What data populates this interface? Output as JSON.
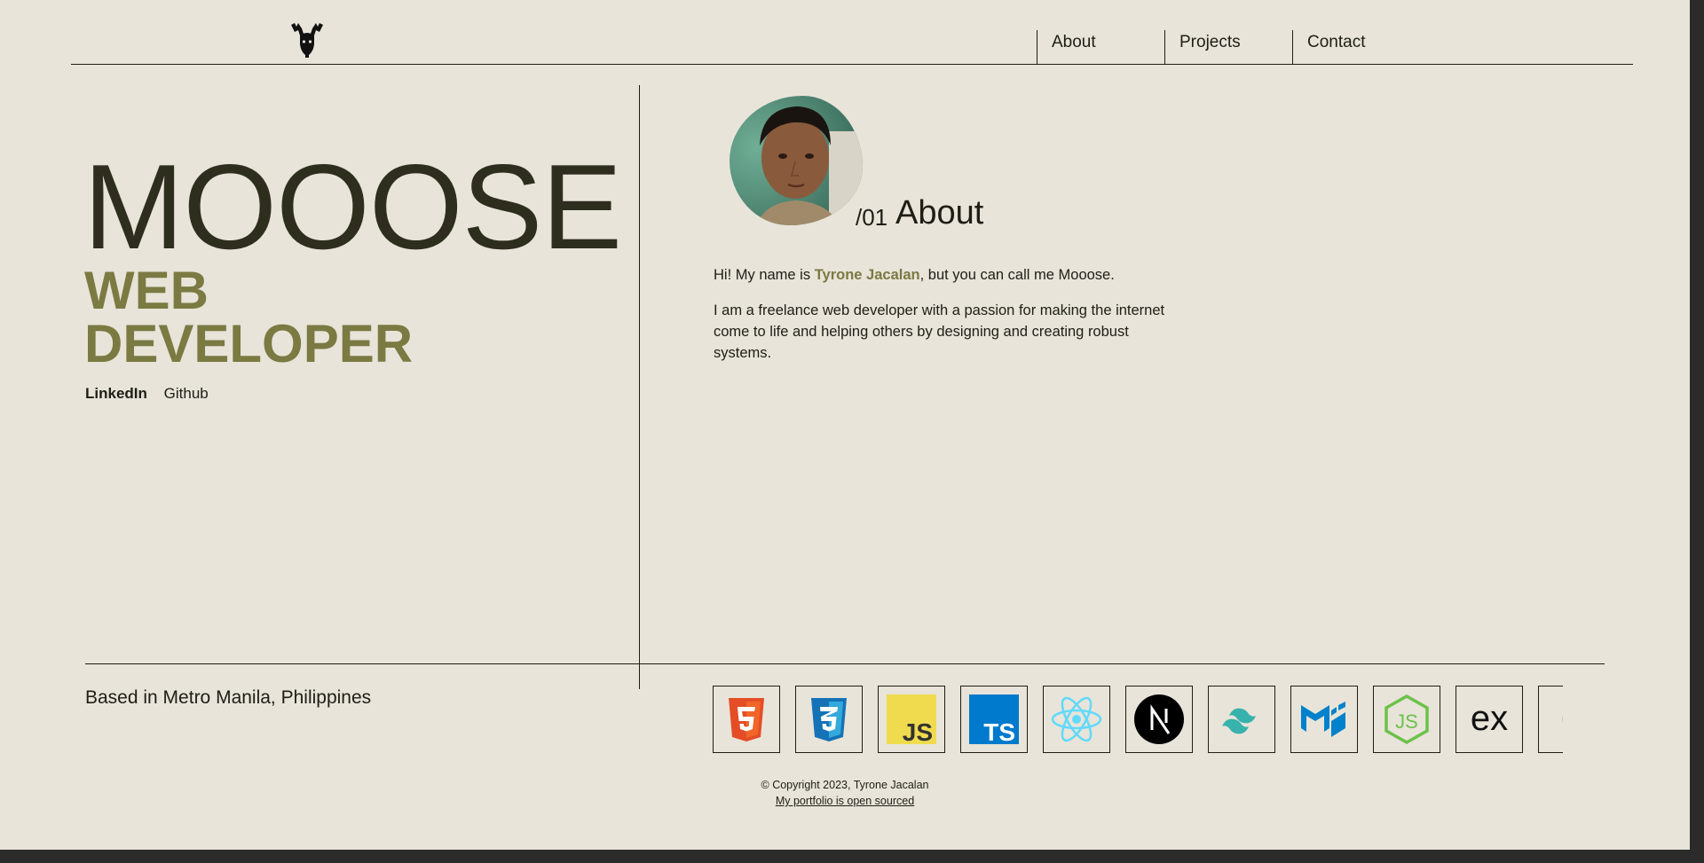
{
  "nav": {
    "logo_icon": "moose-head-icon",
    "items": [
      {
        "label": "About"
      },
      {
        "label": "Projects"
      },
      {
        "label": "Contact"
      }
    ]
  },
  "hero": {
    "name": "MOOOSE",
    "role_line1": "WEB",
    "role_line2": "DEVELOPER",
    "socials": [
      {
        "label": "LinkedIn"
      },
      {
        "label": "Github"
      }
    ],
    "location": "Based in Metro Manila, Philippines"
  },
  "about": {
    "section_number": "/01",
    "section_title": "About",
    "intro_prefix": "Hi! My name is ",
    "intro_name": "Tyrone Jacalan",
    "intro_suffix": ", but you can call me Mooose.",
    "paragraph": "I am a freelance web developer with a passion for making the internet come to life and helping others by designing and creating robust systems."
  },
  "tech_icons": [
    "html5-icon",
    "css3-icon",
    "javascript-icon",
    "typescript-icon",
    "react-icon",
    "nextjs-icon",
    "tailwind-icon",
    "mui-icon",
    "nodejs-icon",
    "express-icon",
    "mongodb-icon"
  ],
  "footer": {
    "copyright": "© Copyright 2023, Tyrone Jacalan",
    "source_link": "My portfolio is open sourced"
  },
  "colors": {
    "background": "#e8e4d9",
    "text": "#1e1e16",
    "accent": "#7a7a42",
    "frame": "#2b2b2b"
  }
}
